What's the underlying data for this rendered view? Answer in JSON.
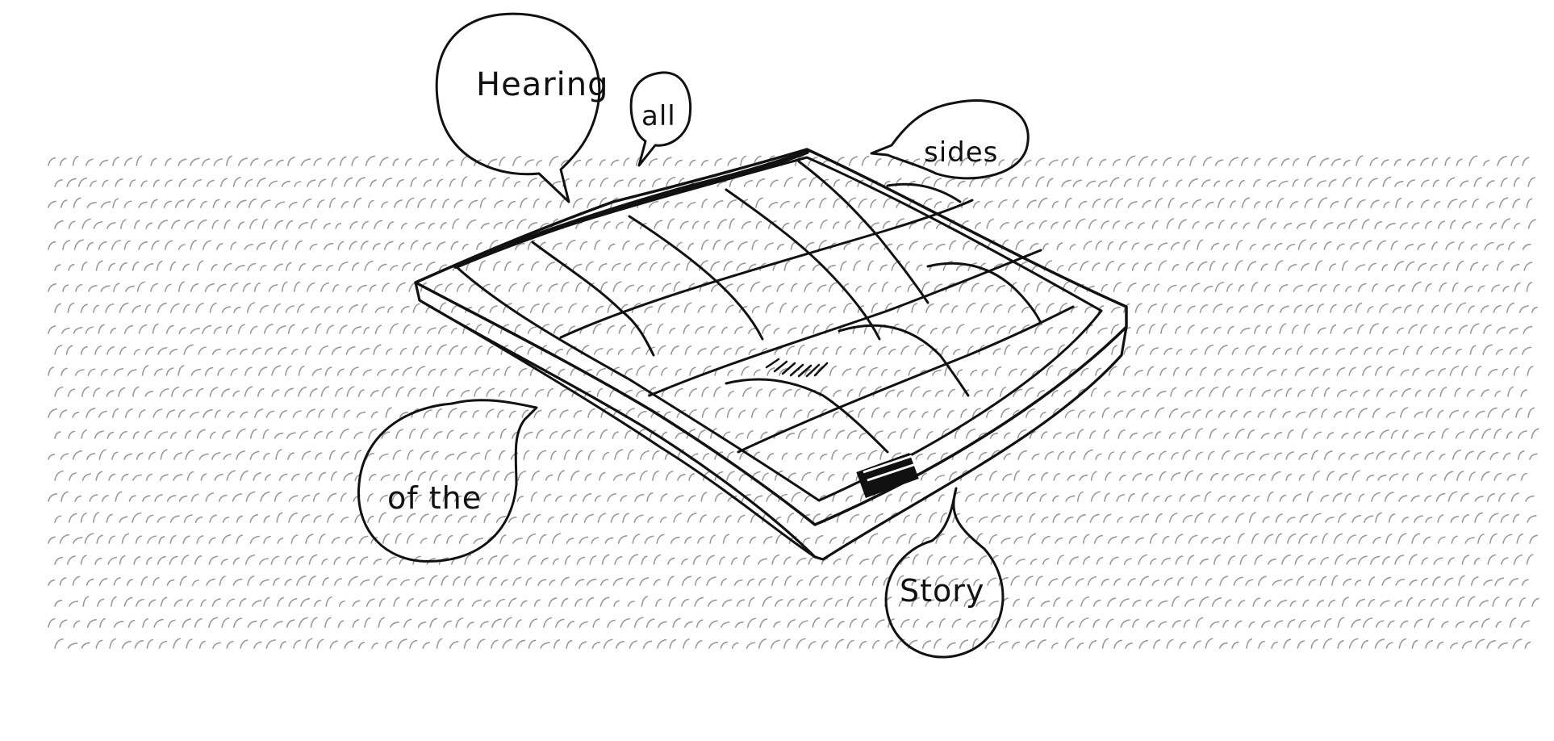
{
  "caption": {
    "words": [
      "Hearing",
      "all",
      "sides",
      "of the",
      "Story"
    ]
  },
  "colors": {
    "ink": "#111111",
    "background": "#ffffff",
    "hatching": "#9a9a9a"
  }
}
